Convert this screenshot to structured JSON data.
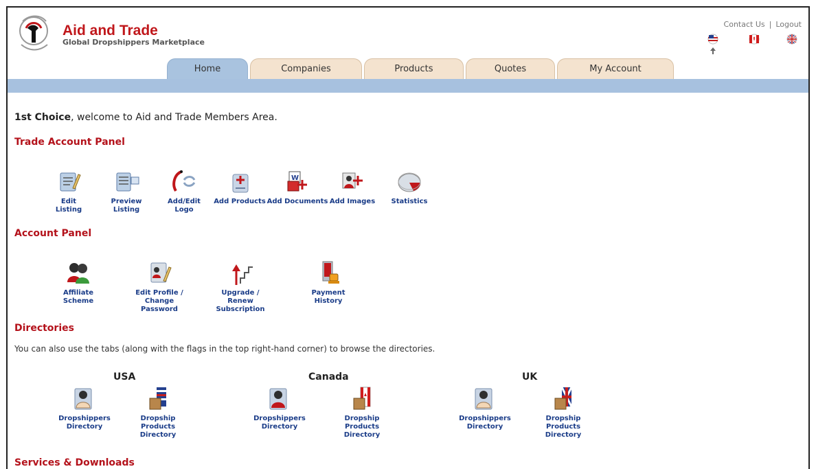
{
  "brand": {
    "title": "Aid and Trade",
    "subtitle": "Global Dropshippers Marketplace"
  },
  "toplinks": {
    "contact": "Contact Us",
    "sep": "|",
    "logout": "Logout"
  },
  "tabs": [
    "Home",
    "Companies",
    "Products",
    "Quotes",
    "My Account"
  ],
  "welcome": {
    "name": "1st Choice",
    "message": ", welcome to Aid and Trade Members Area."
  },
  "sections": {
    "trade": "Trade Account Panel",
    "account": "Account Panel",
    "directories": "Directories",
    "services": "Services & Downloads"
  },
  "trade_items": [
    [
      "Edit",
      "Listing"
    ],
    [
      "Preview",
      "Listing"
    ],
    [
      "Add/Edit",
      "Logo"
    ],
    [
      "Add Products",
      ""
    ],
    [
      "Add Documents",
      ""
    ],
    [
      "Add Images",
      ""
    ],
    [
      "Statistics",
      ""
    ]
  ],
  "account_items": [
    [
      "Affiliate Scheme",
      ""
    ],
    [
      "Edit Profile /",
      "Change Password"
    ],
    [
      "Upgrade / Renew",
      "Subscription"
    ],
    [
      "Payment",
      "History"
    ]
  ],
  "directories_text": "You can also use the tabs (along with the flags in the top right-hand corner) to browse the directories.",
  "countries": [
    "USA",
    "Canada",
    "UK"
  ],
  "dir_items": [
    [
      "Dropshippers",
      "Directory"
    ],
    [
      "Dropship Products",
      "Directory"
    ]
  ],
  "colors": {
    "brand_red": "#c0171b",
    "section_red": "#b4121b",
    "link_blue": "#1a3c88",
    "bar_blue": "#a7c1df",
    "tab_bg": "#f4e3cf"
  }
}
